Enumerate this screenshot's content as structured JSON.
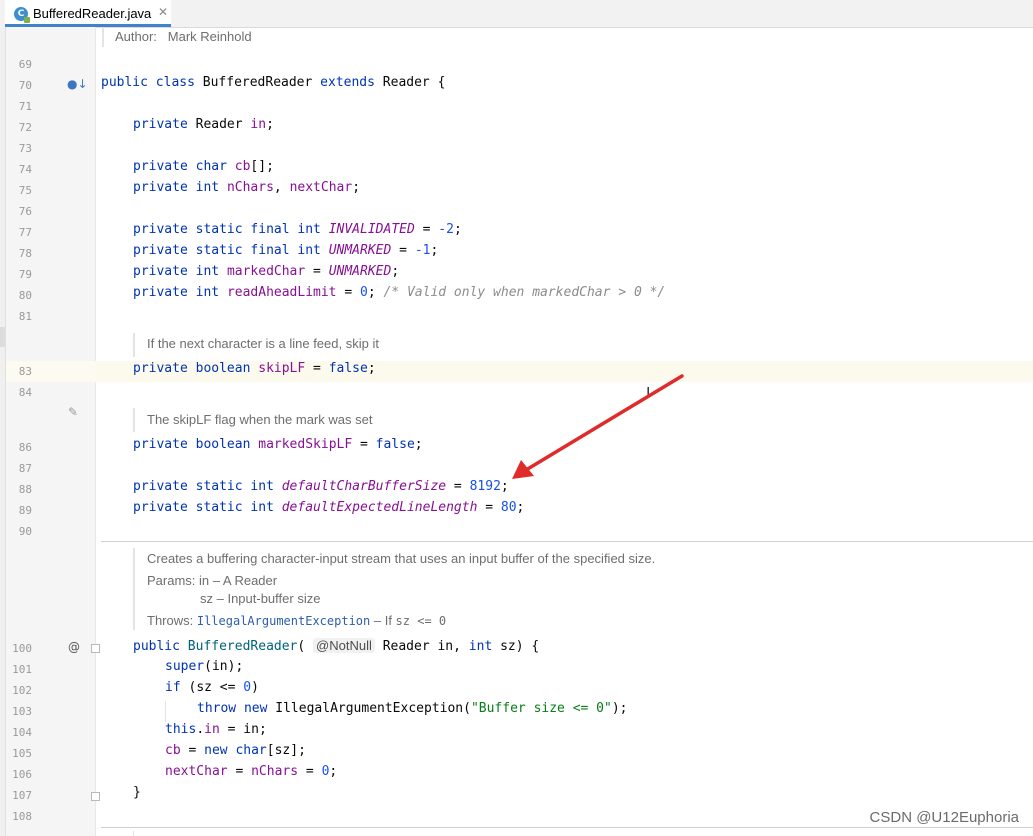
{
  "tab": {
    "title": "BufferedReader.java",
    "icon_letter": "C"
  },
  "doc": {
    "author_label": "Author:",
    "author_name": "Mark Reinhold",
    "skip_lf_doc": "If the next character is a line feed, skip it",
    "marked_skip_doc": "The skipLF flag when the mark was set",
    "ctor_desc": "Creates a buffering character-input stream that uses an input buffer of the specified size.",
    "params_label": "Params:",
    "param_in": "in – A Reader",
    "param_sz": "sz – Input-buffer size",
    "throws_label": "Throws:",
    "throws_type": "IllegalArgumentException",
    "throws_mid": " – If ",
    "throws_cond": "sz <= 0"
  },
  "line_numbers": {
    "l69": "69",
    "l70": "70",
    "l71": "71",
    "l72": "72",
    "l73": "73",
    "l74": "74",
    "l75": "75",
    "l76": "76",
    "l77": "77",
    "l78": "78",
    "l79": "79",
    "l80": "80",
    "l81": "81",
    "l83": "83",
    "l84": "84",
    "l86": "86",
    "l87": "87",
    "l88": "88",
    "l89": "89",
    "l90": "90",
    "l100": "100",
    "l101": "101",
    "l102": "102",
    "l103": "103",
    "l104": "104",
    "l105": "105",
    "l106": "106",
    "l107": "107",
    "l108": "108"
  },
  "code": {
    "kw_public": "public",
    "kw_class": "class",
    "kw_extends": "extends",
    "kw_private": "private",
    "kw_static": "static",
    "kw_final": "final",
    "kw_char": "char",
    "kw_int": "int",
    "kw_boolean": "boolean",
    "kw_false": "false",
    "kw_new": "new",
    "kw_super": "super",
    "kw_if": "if",
    "kw_throw": "throw",
    "kw_this": "this",
    "cls_name": "BufferedReader",
    "cls_reader": "Reader",
    "brace_open": " {",
    "brace_close": "}",
    "f_in": "in",
    "f_cb": "cb",
    "f_nchars": "nChars",
    "f_nextchar": "nextChar",
    "f_invalidated": "INVALIDATED",
    "f_unmarked": "UNMARKED",
    "f_markedchar": "markedChar",
    "f_readahead": "readAheadLimit",
    "f_skiplf": "skipLF",
    "f_markedskiplf": "markedSkipLF",
    "f_defcharbuf": "defaultCharBufferSize",
    "f_defline": "defaultExpectedLineLength",
    "n_minus2": "-2",
    "n_minus1": "-1",
    "n_zero": "0",
    "n_8192": "8192",
    "n_80": "80",
    "cmt_80": "/* Valid only when markedChar > 0 */",
    "ann_notnull": "@NotNull",
    "exc_name": "IllegalArgumentException",
    "str_msg": "\"Buffer size <= 0\"",
    "p_in": "in",
    "p_sz": "sz"
  },
  "gutter_icons": {
    "l70": "implements-icon",
    "l84": "edit-icon",
    "l100": "override-icon"
  },
  "watermark": "CSDN @U12Euphoria",
  "colors": {
    "keyword": "#0033b3",
    "field": "#871094",
    "number": "#1750eb",
    "comment": "#8c8c8c",
    "string": "#067d17",
    "arrow": "#e02b2b"
  }
}
